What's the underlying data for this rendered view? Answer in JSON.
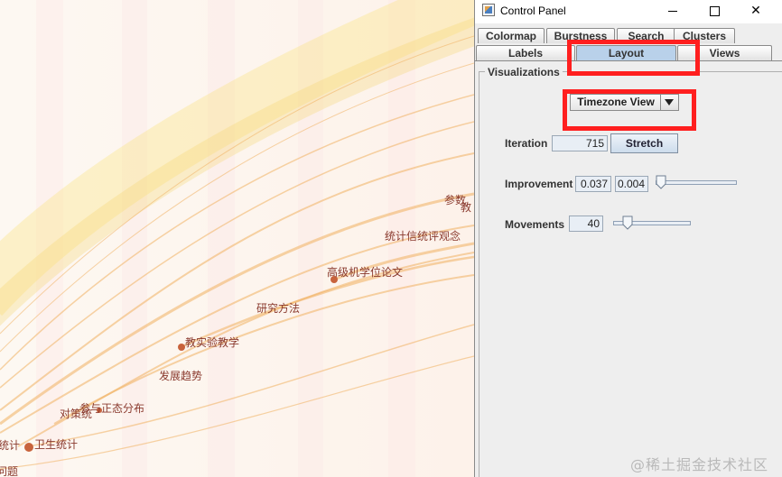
{
  "visualization": {
    "node_labels": [
      "参数",
      "教",
      "统计信统评观念",
      "高级机学位论文",
      "研究方法",
      "教实验教学",
      "发展趋势",
      "参与正态分布",
      "对策统",
      "统计",
      "卫生统计",
      "问题"
    ],
    "accent_color": "#f0c070",
    "label_color": "#8a3a2e"
  },
  "window": {
    "title": "Control Panel",
    "minimize_label": "",
    "maximize_label": "",
    "close_label": "✕"
  },
  "tabs": {
    "row1": [
      "Colormap",
      "Burstness",
      "Search",
      "Clusters"
    ],
    "row2": [
      "Labels",
      "Layout",
      "Views"
    ],
    "active": "Layout"
  },
  "layout_panel": {
    "group_title": "Visualizations",
    "view_select_value": "Timezone View",
    "iteration_label": "Iteration",
    "iteration_value": "715",
    "stretch_label": "Stretch",
    "improvement_label": "Improvement",
    "improvement_value1": "0.037",
    "improvement_value2": "0.004",
    "improvement_slider_level": 0.05,
    "movements_label": "Movements",
    "movements_value": "40",
    "movements_slider_level": 0.18
  },
  "highlight_color": "#ff1f1f",
  "watermark": "@稀土掘金技术社区"
}
